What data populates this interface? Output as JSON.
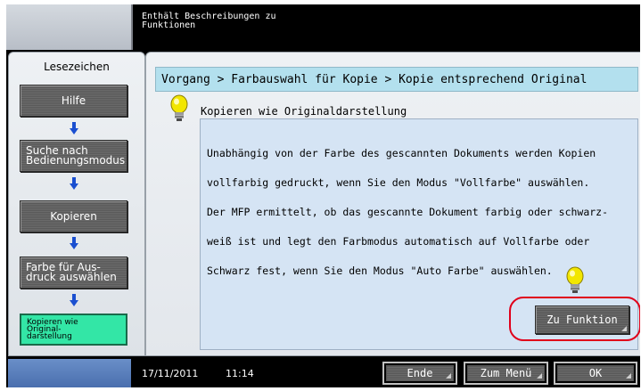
{
  "header": {
    "message_line1": "Enthält Beschreibungen zu",
    "message_line2": "Funktionen"
  },
  "bookmarks": {
    "title": "Lesezeichen",
    "steps": [
      {
        "label_line1": "Hilfe",
        "label_line2": ""
      },
      {
        "label_line1": "Suche nach",
        "label_line2": "Bedienungsmodus"
      },
      {
        "label_line1": "Kopieren",
        "label_line2": ""
      },
      {
        "label_line1": "Farbe für Aus-",
        "label_line2": "druck auswählen"
      },
      {
        "label_line1": "Kopieren wie",
        "label_line2": "Original-",
        "label_line3": "darstellung"
      }
    ]
  },
  "main": {
    "breadcrumb": "Vorgang > Farbauswahl für Kopie > Kopie entsprechend Original",
    "topic_title": "Kopieren wie Originaldarstellung",
    "description_lines": [
      "Unabhängig von der Farbe des gescannten Dokuments werden Kopien",
      "vollfarbig gedruckt, wenn Sie den Modus \"Vollfarbe\" auswählen.",
      "Der MFP ermittelt, ob das gescannte Dokument farbig oder schwarz-",
      "weiß ist und legt den Farbmodus automatisch auf Vollfarbe oder",
      "Schwarz fest, wenn Sie den Modus \"Auto Farbe\" auswählen."
    ],
    "function_button": "Zu Funktion"
  },
  "footer": {
    "date": "17/11/2011",
    "time": "11:14",
    "end_button": "Ende",
    "menu_button": "Zum Menü",
    "ok_button": "OK"
  },
  "colors": {
    "active_step": "#33e6a6",
    "breadcrumb_bg": "#b3e0ee",
    "highlight_ring": "#e0001a",
    "arrow_blue": "#1a4fd0"
  }
}
